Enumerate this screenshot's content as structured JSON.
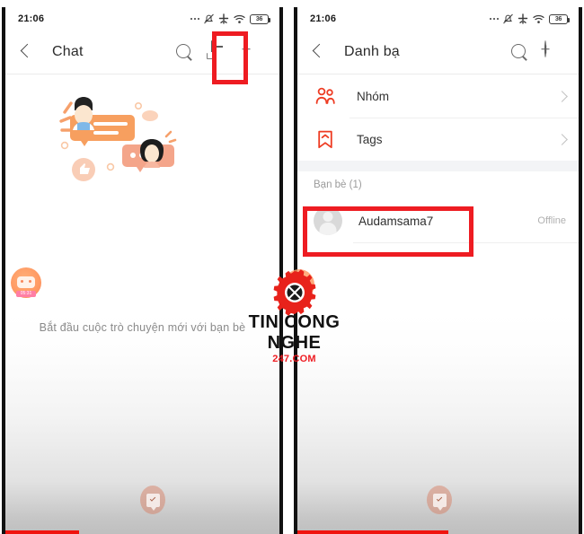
{
  "meta": {
    "accent_red": "#ee1c22",
    "accent_orange": "#f8865a",
    "bg": "#ffffff"
  },
  "status_bar": {
    "time": "21:06",
    "battery_level": "36",
    "icons": [
      "more-dots-icon",
      "mute-bell-icon",
      "airplane-mode-icon",
      "wifi-icon",
      "battery-icon"
    ]
  },
  "left_panel": {
    "header": {
      "back_label": "back",
      "title": "Chat",
      "search_label": "search",
      "note_label": "new note",
      "add_label": "add"
    },
    "empty_state": {
      "text": "Bắt đầu cuộc trò chuyện mới với bạn bè"
    },
    "mini_badge_text": "05:31"
  },
  "right_panel": {
    "header": {
      "back_label": "back",
      "title": "Danh bạ",
      "search_label": "search",
      "add_label": "add"
    },
    "menu": [
      {
        "label": "Nhóm",
        "icon": "group-people-icon"
      },
      {
        "label": "Tags",
        "icon": "bookmark-tag-icon"
      }
    ],
    "section_title": "Bạn bè (1)",
    "contacts": [
      {
        "name": "Audamsama7",
        "status": "Offline",
        "avatar": "default-avatar"
      }
    ]
  },
  "watermark": {
    "title": "TIN CONG NGHE",
    "subtitle": "247.COM",
    "logo": "gear-icon"
  },
  "annotations": [
    {
      "id": "note-icon-highlight",
      "target": "left note icon"
    },
    {
      "id": "contact-row-highlight",
      "target": "Audamsama7 row"
    }
  ]
}
